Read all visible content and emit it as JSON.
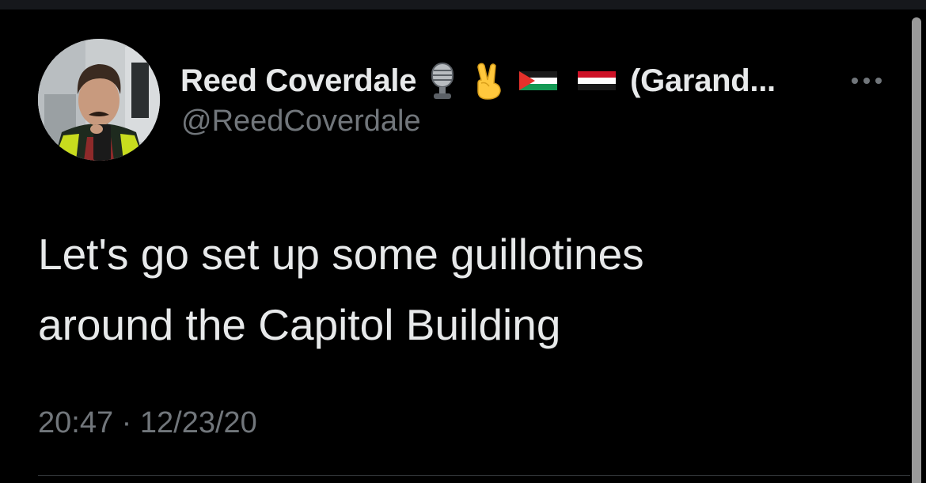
{
  "tweet": {
    "author": {
      "display_name": "Reed Coverdale",
      "name_tail": "(Garand...",
      "emojis": [
        "microphone-emoji",
        "victory-hand-emoji",
        "palestine-flag-emoji",
        "yemen-flag-emoji"
      ],
      "handle": "@ReedCoverdale"
    },
    "text_lines": [
      "Let's go set up some guillotines",
      "around the Capitol Building"
    ],
    "time": "20:47",
    "separator": "·",
    "date": "12/23/20"
  },
  "icons": {
    "more": "more-dots-icon"
  },
  "colors": {
    "background": "#000000",
    "primary_text": "#e7e9ea",
    "secondary_text": "#71767b",
    "divider": "#2f3336"
  }
}
